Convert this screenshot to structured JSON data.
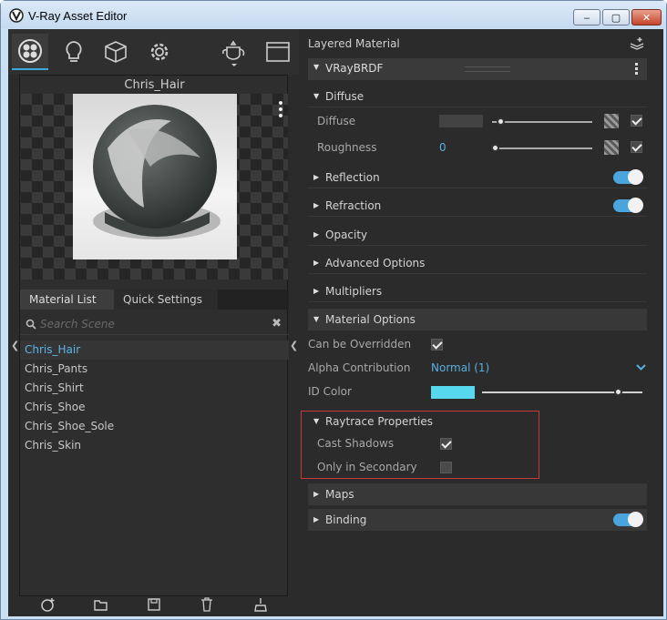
{
  "window": {
    "title": "V-Ray Asset Editor",
    "controls": {
      "minimize": "‒",
      "maximize": "▢",
      "close": "✕"
    }
  },
  "toolbar": {
    "icons": [
      "materials-icon",
      "lights-icon",
      "geometry-icon",
      "settings-icon",
      "render-teapot-icon",
      "frame-buffer-icon"
    ]
  },
  "preview": {
    "material_name": "Chris_Hair"
  },
  "left_tabs": {
    "material_list": "Material List",
    "quick_settings": "Quick Settings"
  },
  "search": {
    "placeholder": "Search Scene",
    "clear": "✖"
  },
  "materials": [
    {
      "name": "Chris_Hair",
      "selected": true
    },
    {
      "name": "Chris_Pants",
      "selected": false
    },
    {
      "name": "Chris_Shirt",
      "selected": false
    },
    {
      "name": "Chris_Shoe",
      "selected": false
    },
    {
      "name": "Chris_Shoe_Sole",
      "selected": false
    },
    {
      "name": "Chris_Skin",
      "selected": false
    }
  ],
  "bottom_tools": [
    "add-material-icon",
    "open-folder-icon",
    "save-icon",
    "delete-icon",
    "purge-icon"
  ],
  "right": {
    "header": "Layered Material",
    "brdf_label": "VRayBRDF",
    "diffuse_section": "Diffuse",
    "diffuse": {
      "label": "Diffuse",
      "value": ""
    },
    "roughness": {
      "label": "Roughness",
      "value": "0"
    },
    "reflection": "Reflection",
    "refraction": "Refraction",
    "opacity": "Opacity",
    "advanced_options": "Advanced Options",
    "multipliers": "Multipliers",
    "material_options": "Material Options",
    "can_be_overridden": {
      "label": "Can be Overridden",
      "checked": true
    },
    "alpha_contribution": {
      "label": "Alpha Contribution",
      "value": "Normal (1)"
    },
    "id_color": {
      "label": "ID Color",
      "color": "#56d8ef"
    },
    "raytrace_properties": "Raytrace Properties",
    "cast_shadows": {
      "label": "Cast Shadows",
      "checked": true
    },
    "only_in_secondary": {
      "label": "Only in Secondary",
      "checked": false
    },
    "maps": "Maps",
    "binding": "Binding"
  },
  "colors": {
    "accent": "#4aa5dc",
    "highlight_box": "#c23a3a",
    "panel_bg": "#2b2b2b"
  }
}
